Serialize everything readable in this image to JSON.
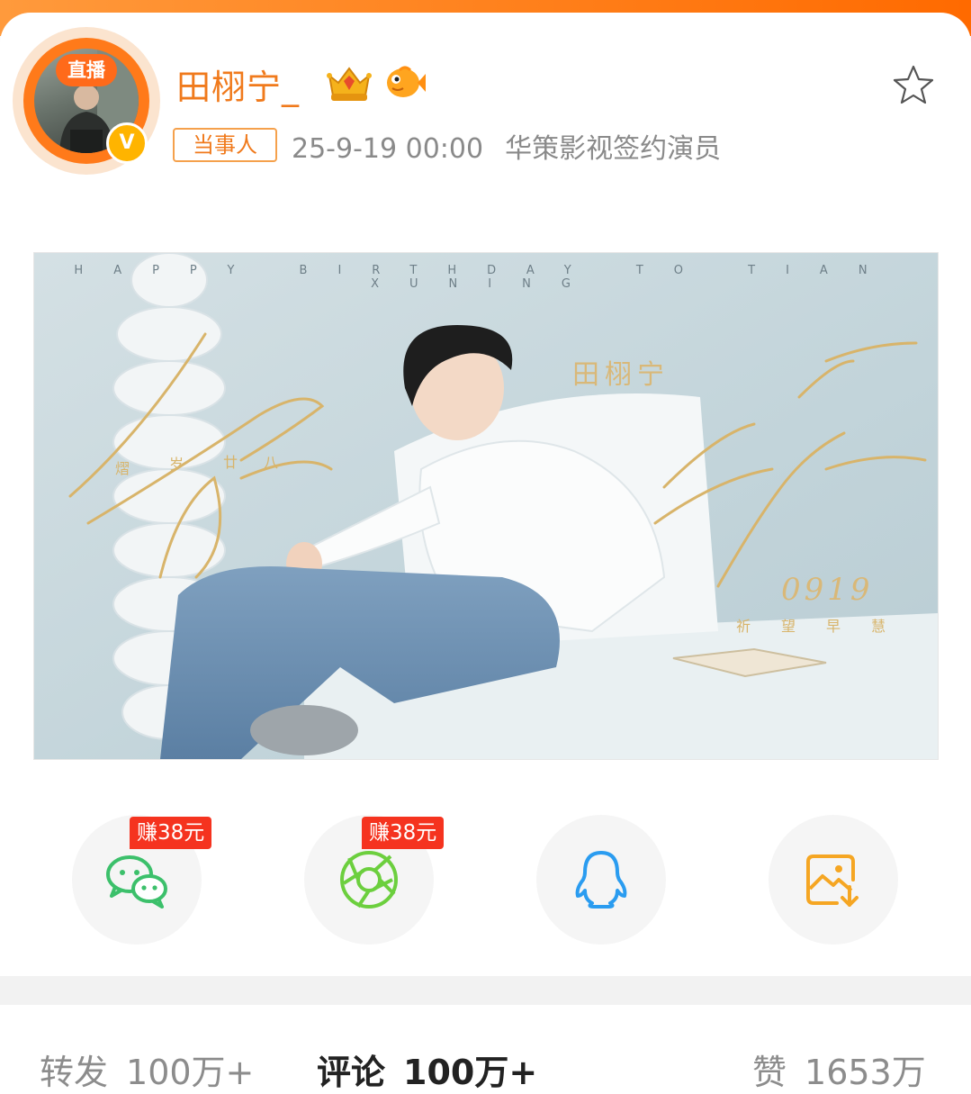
{
  "post": {
    "avatar_live_label": "直播",
    "verified_mark": "V",
    "username": "田栩宁_",
    "tag": "当事人",
    "time": "25-9-19 00:00",
    "source": "华策影视签约演员"
  },
  "poster": {
    "caption": "HAPPY BIRTHDAY TO TIAN XUNING",
    "name": "田栩宁",
    "date": "0919"
  },
  "share": {
    "items": [
      {
        "name": "wechat",
        "icon": "wechat-icon",
        "badge": "赚38元"
      },
      {
        "name": "moments",
        "icon": "moments-icon",
        "badge": "赚38元"
      },
      {
        "name": "qq",
        "icon": "qq-icon"
      },
      {
        "name": "save-image",
        "icon": "save-image-icon"
      }
    ]
  },
  "stats": {
    "repost_label": "转发",
    "repost_value": "100万+",
    "comment_label": "评论",
    "comment_value": "100万+",
    "like_label": "赞",
    "like_value": "1653万"
  },
  "colors": {
    "accent": "#f07a1c",
    "wechat": "#3cc06b",
    "moments": "#6ccf3e",
    "qq": "#2a9cf0",
    "save": "#f5a623",
    "badge": "#f5331f"
  }
}
